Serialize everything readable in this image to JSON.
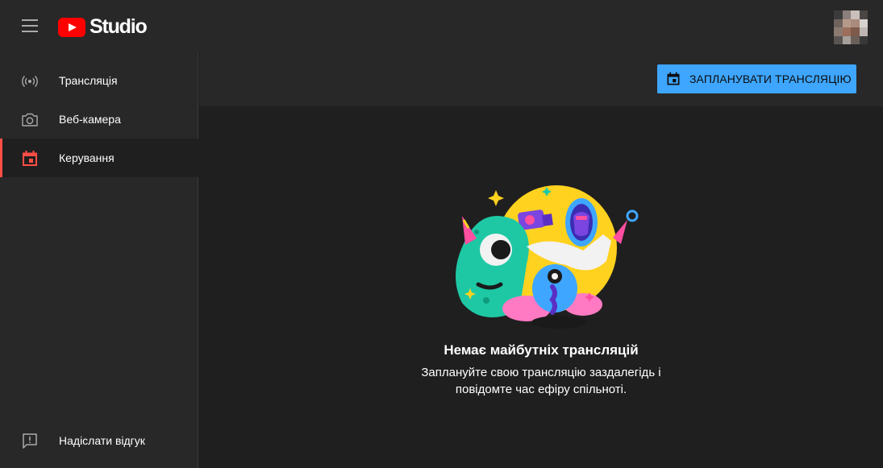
{
  "app": {
    "logo_text": "Studio"
  },
  "sidebar": {
    "items": [
      {
        "label": "Трансляція",
        "icon": "broadcast-icon"
      },
      {
        "label": "Веб-камера",
        "icon": "camera-icon"
      },
      {
        "label": "Керування",
        "icon": "calendar-icon",
        "active": true
      }
    ],
    "feedback": {
      "label": "Надіслати відгук",
      "icon": "feedback-icon"
    }
  },
  "toolbar": {
    "schedule_label": "ЗАПЛАНУВАТИ ТРАНСЛЯЦІЮ",
    "schedule_icon": "calendar-icon"
  },
  "empty_state": {
    "title": "Немає майбутніх трансляцій",
    "description": "Заплануйте свою трансляцію заздалегідь і повідомте час ефіру спільноті."
  },
  "colors": {
    "accent": "#3ea6ff",
    "active_indicator": "#ff4e45",
    "brand_red": "#ff0000"
  }
}
